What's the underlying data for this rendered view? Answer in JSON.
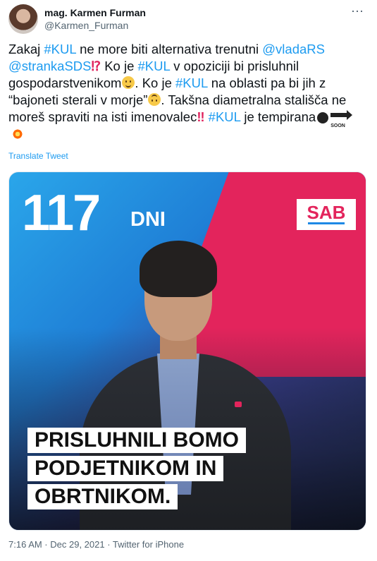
{
  "author": {
    "name": "mag. Karmen Furman",
    "handle": "@Karmen_Furman"
  },
  "more_icon": "more-icon",
  "tweet": {
    "p1": "Zakaj ",
    "hashtag_kul": "#KUL",
    "p2": " ne more biti alternativa trenutni ",
    "mention_vlada": "@vladaRS",
    "mention_sds": "@strankaSDS",
    "p3": " Ko je ",
    "p4": " v opoziciji bi prisluhnil gospodarstvenikom",
    "p5": ". Ko je ",
    "p6": " na oblasti pa bi jih z “bajoneti sterali v morje”",
    "p7": ". Takšna diametralna stališča ne moreš spraviti na isti imenovalec",
    "p8": " ",
    "p9": " je tempirana",
    "interrobang": "⁉",
    "double_exclaim": "‼",
    "soon_label": "SOON"
  },
  "translate_label": "Translate Tweet",
  "media": {
    "counter_number": "117",
    "counter_unit": "DNI",
    "logo": "SAB",
    "caption_lines": [
      "PRISLUHNILI BOMO",
      "PODJETNIKOM IN",
      "OBRTNIKOM."
    ]
  },
  "footer": "7:16 AM · Dec 29, 2021 · Twitter for iPhone",
  "colors": {
    "link": "#1d9bf0",
    "accent_pink": "#e3245c",
    "text": "#0f1419",
    "muted": "#536471"
  }
}
